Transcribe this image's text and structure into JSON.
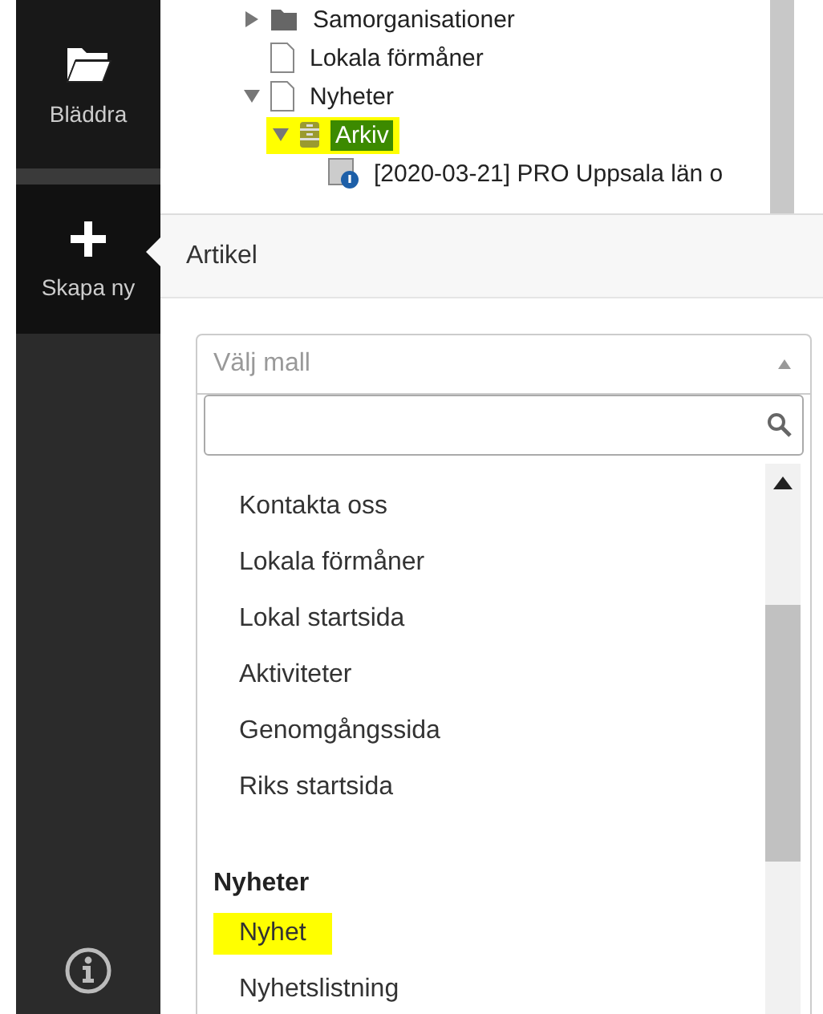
{
  "sidebar": {
    "items": [
      {
        "kind": "folder",
        "label": "Bläddra",
        "selected": false
      },
      {
        "kind": "plus",
        "label": "Skapa ny",
        "selected": true
      }
    ]
  },
  "tree": [
    {
      "label": "Samorganisationer",
      "kind": "folder",
      "expanded": false,
      "selected": false,
      "highlighted": false
    },
    {
      "label": "Lokala förmåner",
      "kind": "page",
      "selected": false,
      "highlighted": false
    },
    {
      "label": "Nyheter",
      "kind": "page",
      "expanded": true,
      "selected": false,
      "highlighted": false,
      "children": [
        {
          "label": "Arkiv",
          "kind": "container",
          "expanded": true,
          "selected": true,
          "highlighted": true,
          "children": [
            {
              "label": "[2020-03-21] PRO Uppsala län o",
              "kind": "news",
              "selected": false,
              "highlighted": false
            }
          ]
        }
      ]
    }
  ],
  "popover": {
    "title": "Artikel",
    "select": {
      "placeholder": "Välj mall",
      "open": true
    },
    "options": [
      {
        "kind": "option",
        "label": "Kontakta oss",
        "highlighted": false
      },
      {
        "kind": "option",
        "label": "Lokala förmåner",
        "highlighted": false
      },
      {
        "kind": "option",
        "label": "Lokal startsida",
        "highlighted": false
      },
      {
        "kind": "option",
        "label": "Aktiviteter",
        "highlighted": false
      },
      {
        "kind": "option",
        "label": "Genomgångssida",
        "highlighted": false
      },
      {
        "kind": "option",
        "label": "Riks startsida",
        "highlighted": false
      },
      {
        "kind": "group",
        "label": "Nyheter"
      },
      {
        "kind": "option",
        "label": "Nyhet",
        "highlighted": true
      },
      {
        "kind": "option",
        "label": "Nyhetslistning",
        "highlighted": false
      }
    ]
  }
}
